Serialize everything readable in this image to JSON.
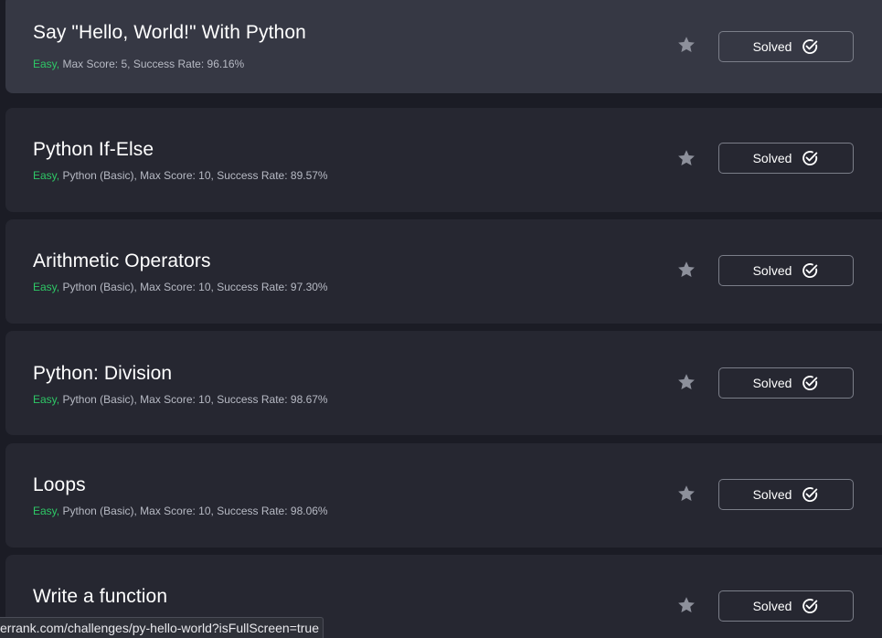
{
  "challenges": [
    {
      "title": "Say \"Hello, World!\" With Python",
      "difficulty": "Easy,",
      "details": " Max Score: 5, Success Rate: 96.16%",
      "status_label": "Solved"
    },
    {
      "title": "Python If-Else",
      "difficulty": "Easy,",
      "details": " Python (Basic), Max Score: 10, Success Rate: 89.57%",
      "status_label": "Solved"
    },
    {
      "title": "Arithmetic Operators",
      "difficulty": "Easy,",
      "details": " Python (Basic), Max Score: 10, Success Rate: 97.30%",
      "status_label": "Solved"
    },
    {
      "title": "Python: Division",
      "difficulty": "Easy,",
      "details": " Python (Basic), Max Score: 10, Success Rate: 98.67%",
      "status_label": "Solved"
    },
    {
      "title": "Loops",
      "difficulty": "Easy,",
      "details": " Python (Basic), Max Score: 10, Success Rate: 98.06%",
      "status_label": "Solved"
    },
    {
      "title": "Write a function",
      "difficulty": "",
      "details": "",
      "status_label": "Solved"
    }
  ],
  "icons": {
    "star": "star-icon",
    "solved": "check-circle-icon"
  },
  "colors": {
    "difficulty_easy": "#2ec866",
    "card_bg": "#262731",
    "card_hover_bg": "#363844",
    "page_bg": "#1b1c25"
  },
  "status_bar": {
    "url": "errank.com/challenges/py-hello-world?isFullScreen=true"
  }
}
